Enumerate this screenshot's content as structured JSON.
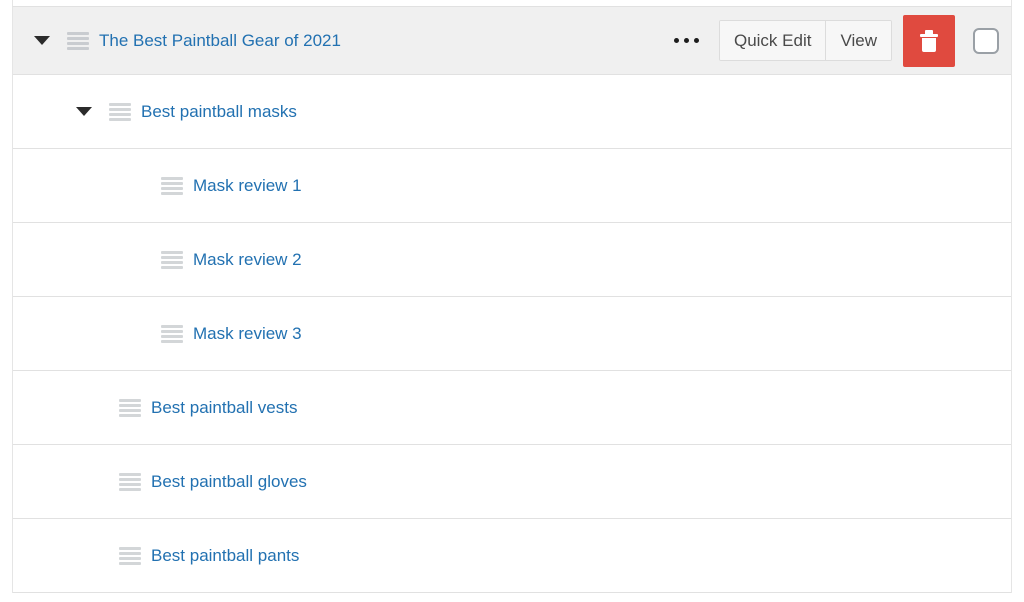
{
  "accent": {
    "link_color": "#2271b1",
    "delete_button_bg": "#e04a3f",
    "parent_row_bg": "#f0f0f0",
    "row_border": "#e1e1e1",
    "handle_color": "#d3d6d8"
  },
  "toolbar": {
    "more_options_label": "•••",
    "quick_edit_label": "Quick Edit",
    "view_label": "View",
    "delete_label": "Delete",
    "select_label": "Select row",
    "checkbox_checked": false
  },
  "rows": [
    {
      "title": "The Best Paintball Gear of 2021",
      "level": 0,
      "expanded": true,
      "has_toggle": true,
      "selected": true,
      "has_actions": true
    },
    {
      "title": "Best paintball masks",
      "level": 1,
      "expanded": true,
      "has_toggle": true,
      "selected": false,
      "has_actions": false
    },
    {
      "title": "Mask review 1",
      "level": 2,
      "expanded": false,
      "has_toggle": false,
      "selected": false,
      "has_actions": false
    },
    {
      "title": "Mask review 2",
      "level": 2,
      "expanded": false,
      "has_toggle": false,
      "selected": false,
      "has_actions": false
    },
    {
      "title": "Mask review 3",
      "level": 2,
      "expanded": false,
      "has_toggle": false,
      "selected": false,
      "has_actions": false
    },
    {
      "title": "Best paintball vests",
      "level": 1,
      "expanded": false,
      "has_toggle": false,
      "selected": false,
      "has_actions": false
    },
    {
      "title": "Best paintball gloves",
      "level": 1,
      "expanded": false,
      "has_toggle": false,
      "selected": false,
      "has_actions": false
    },
    {
      "title": "Best paintball pants",
      "level": 1,
      "expanded": false,
      "has_toggle": false,
      "selected": false,
      "has_actions": false
    }
  ]
}
